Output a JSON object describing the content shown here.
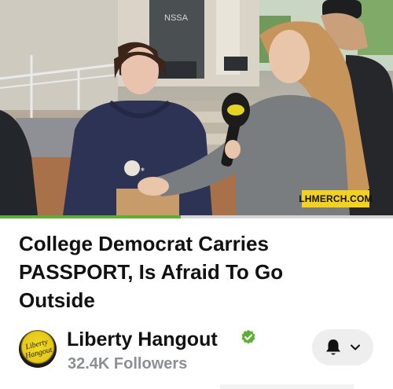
{
  "video": {
    "watermark": "LHMERCH.COM",
    "sign_text": "NSSA",
    "progress_fraction": 0.46
  },
  "title": {
    "line1": "College Democrat Carries",
    "line2": "PASSPORT, Is Afraid To Go",
    "line3": "Outside"
  },
  "channel": {
    "name": "Liberty Hangout",
    "followers": "32.4K Followers",
    "avatar_text": "Liberty Hangout",
    "verified_color": "#5ab031"
  },
  "icons": {
    "bell": "bell-icon",
    "chevron": "chevron-down-icon",
    "verified": "verified-check-icon"
  }
}
